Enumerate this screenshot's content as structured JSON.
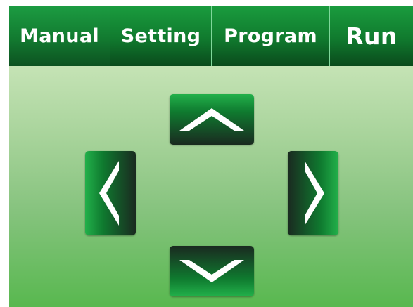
{
  "tabs": [
    {
      "id": "manual",
      "label": "Manual",
      "active": true
    },
    {
      "id": "setting",
      "label": "Setting",
      "active": false
    },
    {
      "id": "program",
      "label": "Program",
      "active": false
    },
    {
      "id": "run",
      "label": "Run",
      "active": false
    }
  ],
  "controls": {
    "up": {
      "icon": "chevron-up-icon"
    },
    "down": {
      "icon": "chevron-down-icon"
    },
    "left": {
      "icon": "chevron-left-icon"
    },
    "right": {
      "icon": "chevron-right-icon"
    }
  },
  "colors": {
    "tab_green": "#107a2e",
    "tab_divider": "#7fd79a",
    "panel_top": "#c5e3b5",
    "panel_bottom": "#58b84f",
    "button_dark": "#1a2a20",
    "button_bright": "#22b04a",
    "arrow": "#ffffff"
  }
}
